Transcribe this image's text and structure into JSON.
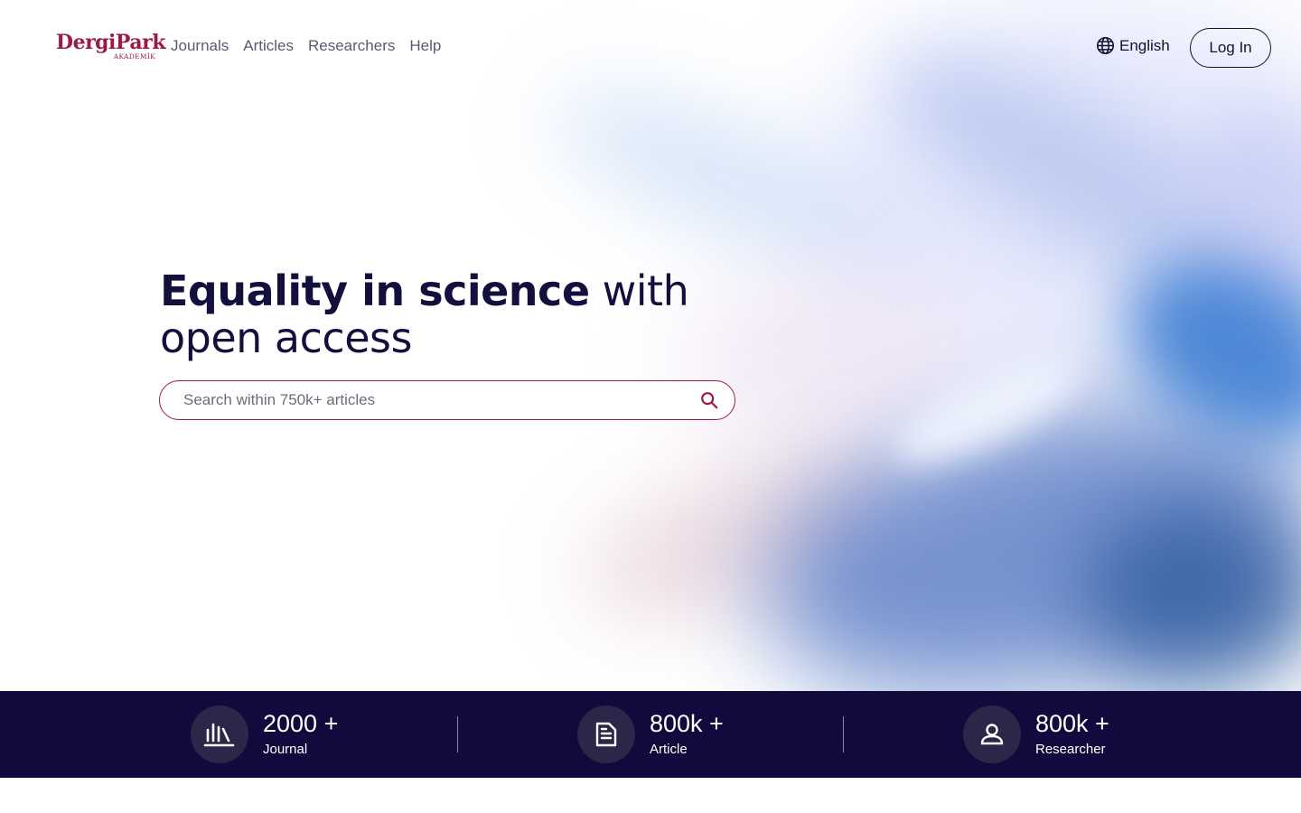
{
  "header": {
    "logo": {
      "main": "DergiPark",
      "sub": "AKADEMİK"
    },
    "nav": [
      {
        "label": "Journals"
      },
      {
        "label": "Articles"
      },
      {
        "label": "Researchers"
      },
      {
        "label": "Help"
      }
    ],
    "language": {
      "label": "English",
      "icon": "globe-icon"
    },
    "login_label": "Log In"
  },
  "hero": {
    "title_strong": "Equality in science",
    "title_rest_line1": " with",
    "title_line2": "open access",
    "search": {
      "placeholder": "Search within 750k+ articles",
      "icon": "search-icon"
    }
  },
  "stats": [
    {
      "icon": "library-icon",
      "value": "2000 +",
      "label": "Journal"
    },
    {
      "icon": "article-icon",
      "value": "800k +",
      "label": "Article"
    },
    {
      "icon": "person-icon",
      "value": "800k +",
      "label": "Researcher"
    }
  ],
  "colors": {
    "brand": "#9b1b48",
    "heading": "#14103e",
    "stats_background": "#120a3c",
    "stats_icon_background": "#2c2748"
  }
}
